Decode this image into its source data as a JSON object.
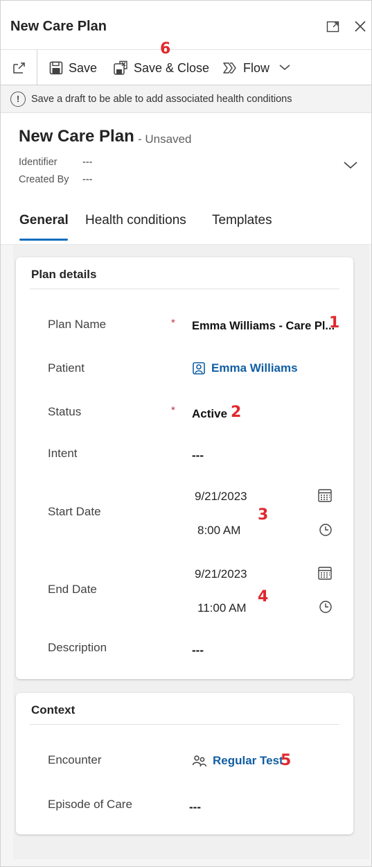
{
  "window": {
    "title": "New Care Plan",
    "expand_icon": "expand-icon",
    "close_icon": "close-icon"
  },
  "commandbar": {
    "popout_icon": "open-in-new-window-icon",
    "save_label": "Save",
    "save_close_label": "Save & Close",
    "flow_label": "Flow",
    "annotation": "6"
  },
  "notice": {
    "icon": "info-icon",
    "icon_glyph": "!",
    "text": "Save a draft to be able to add associated health conditions"
  },
  "header": {
    "title": "New Care Plan",
    "status": "- Unsaved",
    "identifier_label": "Identifier",
    "identifier_value": "---",
    "created_by_label": "Created By",
    "created_by_value": "---"
  },
  "tabs": [
    {
      "label": "General",
      "active": true
    },
    {
      "label": "Health conditions",
      "active": false
    },
    {
      "label": "Templates",
      "active": false
    }
  ],
  "plan_details": {
    "title": "Plan details",
    "plan_name": {
      "label": "Plan Name",
      "required": "*",
      "value": "Emma Williams - Care Pl...",
      "annotation": "1"
    },
    "patient": {
      "label": "Patient",
      "value": "Emma Williams"
    },
    "status": {
      "label": "Status",
      "required": "*",
      "value": "Active",
      "annotation": "2"
    },
    "intent": {
      "label": "Intent",
      "value": "---"
    },
    "start_date": {
      "label": "Start Date",
      "date": "9/21/2023",
      "time": "8:00 AM",
      "annotation": "3"
    },
    "end_date": {
      "label": "End Date",
      "date": "9/21/2023",
      "time": "11:00 AM",
      "annotation": "4"
    },
    "description": {
      "label": "Description",
      "value": "---"
    }
  },
  "context": {
    "title": "Context",
    "encounter": {
      "label": "Encounter",
      "value": "Regular Test",
      "annotation": "5"
    },
    "episode_of_care": {
      "label": "Episode of Care",
      "value": "---"
    }
  },
  "colors": {
    "accent": "#0f6cbd",
    "link": "#115ea3",
    "required": "#c4314b",
    "annotation": "#e0282e"
  }
}
